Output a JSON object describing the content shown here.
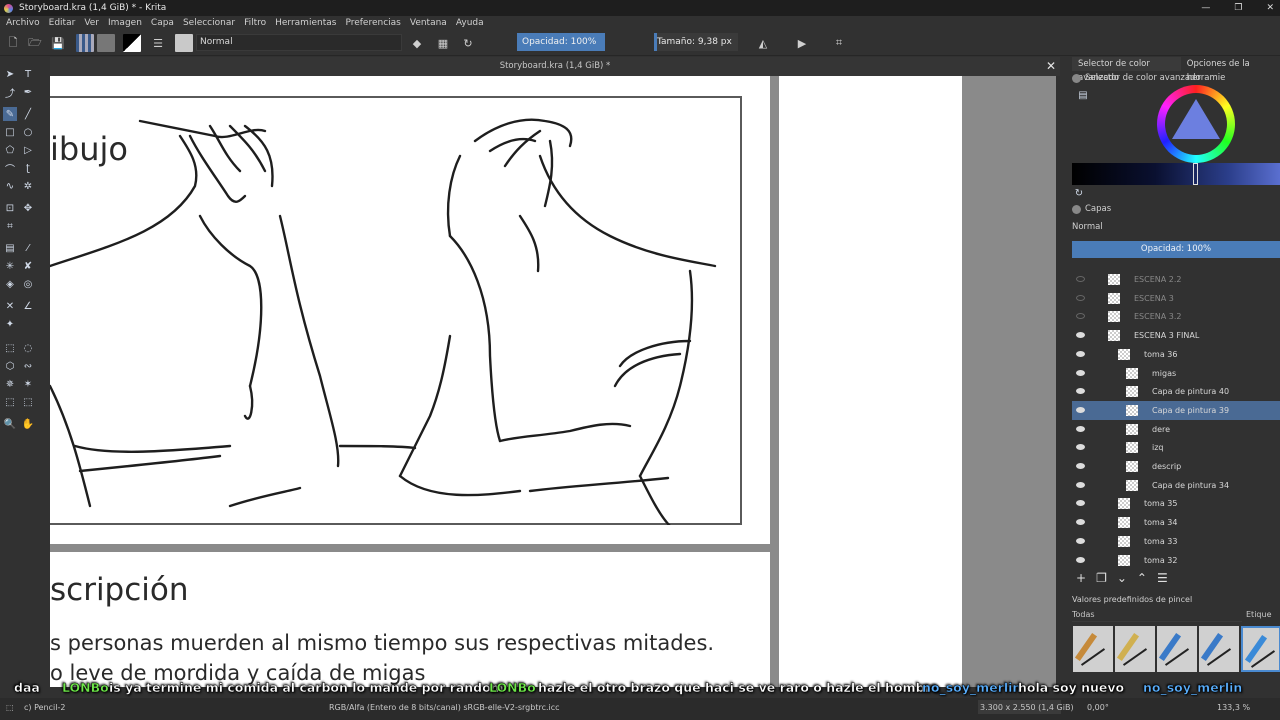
{
  "window": {
    "title": "Storyboard.kra (1,4 GiB) * - Krita",
    "controls": [
      "—",
      "❐",
      "✕"
    ]
  },
  "menu": [
    "Archivo",
    "Editar",
    "Ver",
    "Imagen",
    "Capa",
    "Seleccionar",
    "Filtro",
    "Herramientas",
    "Preferencias",
    "Ventana",
    "Ayuda"
  ],
  "toolbar": {
    "blend_mode": "Normal",
    "opacity_label": "Opacidad: 100%",
    "size_label": "Tamaño: 9,38 px",
    "size_fraction": 0.03
  },
  "document": {
    "tab_title": "Storyboard.kra (1,4 GiB) *",
    "heading_top": "ibujo",
    "heading_desc": "scripción",
    "desc_line1": "s personas muerden al mismo tiempo sus respectivas mitades.",
    "desc_line2": "o leve de mordida y caída de migas"
  },
  "dock": {
    "tabs": [
      "Selector de color avanzado",
      "Opciones de la herramie"
    ],
    "color_panel_title": "Selector de color avanzado",
    "layers_title": "Capas",
    "layers_blend": "Normal",
    "layers_opacity": "Opacidad:  100%",
    "layers": [
      {
        "name": "ESCENA 2.2",
        "visible": false,
        "dim": true,
        "selected": false
      },
      {
        "name": "ESCENA 3",
        "visible": false,
        "dim": true,
        "selected": false
      },
      {
        "name": "ESCENA 3.2",
        "visible": false,
        "dim": true,
        "selected": false
      },
      {
        "name": "ESCENA 3 FINAL",
        "visible": true,
        "dim": false,
        "selected": false
      },
      {
        "name": "toma 36",
        "visible": true,
        "dim": false,
        "selected": false
      },
      {
        "name": "migas",
        "visible": true,
        "dim": false,
        "selected": false
      },
      {
        "name": "Capa de pintura 40",
        "visible": true,
        "dim": false,
        "selected": false
      },
      {
        "name": "Capa de pintura 39",
        "visible": true,
        "dim": false,
        "selected": true
      },
      {
        "name": "dere",
        "visible": true,
        "dim": false,
        "selected": false
      },
      {
        "name": "izq",
        "visible": true,
        "dim": false,
        "selected": false
      },
      {
        "name": "descrip",
        "visible": true,
        "dim": false,
        "selected": false
      },
      {
        "name": "Capa de pintura 34",
        "visible": true,
        "dim": false,
        "selected": false
      },
      {
        "name": "toma 35",
        "visible": true,
        "dim": false,
        "selected": false
      },
      {
        "name": "toma 34",
        "visible": true,
        "dim": false,
        "selected": false
      },
      {
        "name": "toma 33",
        "visible": true,
        "dim": false,
        "selected": false
      },
      {
        "name": "toma 32",
        "visible": true,
        "dim": false,
        "selected": false
      }
    ],
    "brush_panel_title": "Valores predefinidos de pincel",
    "brush_filter": "Todas",
    "brush_tag": "Etique"
  },
  "chat": [
    {
      "user": "",
      "text": "daa"
    },
    {
      "user": "LONBo",
      "text": "is ya termine mi comida al carbon lo mande por random"
    },
    {
      "user": "LONBo",
      "text": "hazle el otro brazo que haci se ve raro o hazle el hombro"
    },
    {
      "user": "no_soy_merlin",
      "text": "hola soy nuevo"
    },
    {
      "user": "no_soy_merlin",
      "text": ""
    }
  ],
  "status": {
    "brush": "c) Pencil-2",
    "color_space": "RGB/Alfa (Entero de 8 bits/canal)  sRGB-elle-V2-srgbtrc.icc",
    "dimensions": "3.300 x 2.550 (1,4 GiB)",
    "rotation": "0,00°",
    "zoom": "133,3 %"
  }
}
